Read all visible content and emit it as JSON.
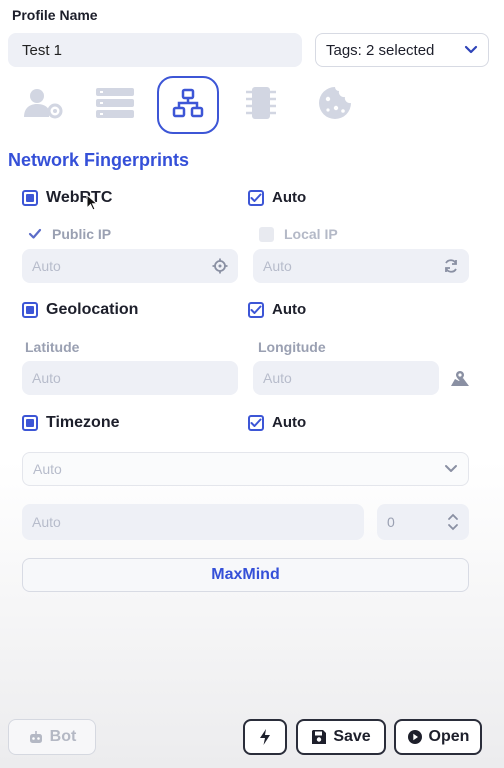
{
  "profile": {
    "label": "Profile Name",
    "name_value": "Test 1",
    "tags_label": "Tags: 2 selected"
  },
  "tabs": [
    {
      "name": "profile-settings-icon",
      "active": false
    },
    {
      "name": "servers-icon",
      "active": false
    },
    {
      "name": "network-icon",
      "active": true
    },
    {
      "name": "chip-icon",
      "active": false
    },
    {
      "name": "cookie-icon",
      "active": false
    }
  ],
  "section_title": "Network Fingerprints",
  "webrtc": {
    "label": "WebRTC",
    "auto_label": "Auto",
    "public_ip_label": "Public IP",
    "local_ip_label": "Local IP",
    "public_ip_placeholder": "Auto",
    "local_ip_placeholder": "Auto"
  },
  "geolocation": {
    "label": "Geolocation",
    "auto_label": "Auto",
    "latitude_label": "Latitude",
    "longitude_label": "Longitude",
    "latitude_placeholder": "Auto",
    "longitude_placeholder": "Auto"
  },
  "timezone": {
    "label": "Timezone",
    "auto_label": "Auto",
    "select_value": "Auto",
    "offset_placeholder": "Auto",
    "stepper_value": "0"
  },
  "maxmind_label": "MaxMind",
  "footer": {
    "bot_label": "Bot",
    "save_label": "Save",
    "open_label": "Open"
  },
  "colors": {
    "accent": "#3d56d6",
    "title": "#3550d8"
  }
}
